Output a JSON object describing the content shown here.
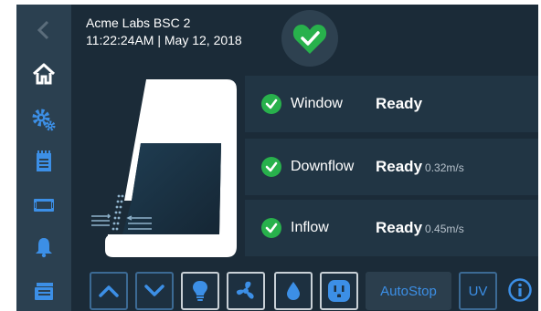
{
  "header": {
    "device_name": "Acme Labs BSC 2",
    "datetime": "11:22:24AM | May 12, 2018",
    "health_icon": "heart-check-icon",
    "health_color": "#28b14c"
  },
  "sidebar": {
    "items": [
      {
        "name": "back",
        "icon": "chevron-left-icon"
      },
      {
        "name": "home",
        "icon": "home-icon",
        "active": true
      },
      {
        "name": "settings",
        "icon": "gears-icon"
      },
      {
        "name": "log",
        "icon": "notepad-icon"
      },
      {
        "name": "display",
        "icon": "screen-icon"
      },
      {
        "name": "alarms",
        "icon": "bell-icon"
      },
      {
        "name": "reports",
        "icon": "document-stack-icon"
      }
    ]
  },
  "status": {
    "rows": [
      {
        "label": "Window",
        "state": "Ready",
        "value": ""
      },
      {
        "label": "Downflow",
        "state": "Ready",
        "value": "0.32m/s"
      },
      {
        "label": "Inflow",
        "state": "Ready",
        "value": "0.45m/s"
      }
    ],
    "ok_color": "#28b14c"
  },
  "controls": {
    "autostop_label": "AutoStop",
    "uv_label": "UV",
    "accent_color": "#3c8fe6"
  }
}
